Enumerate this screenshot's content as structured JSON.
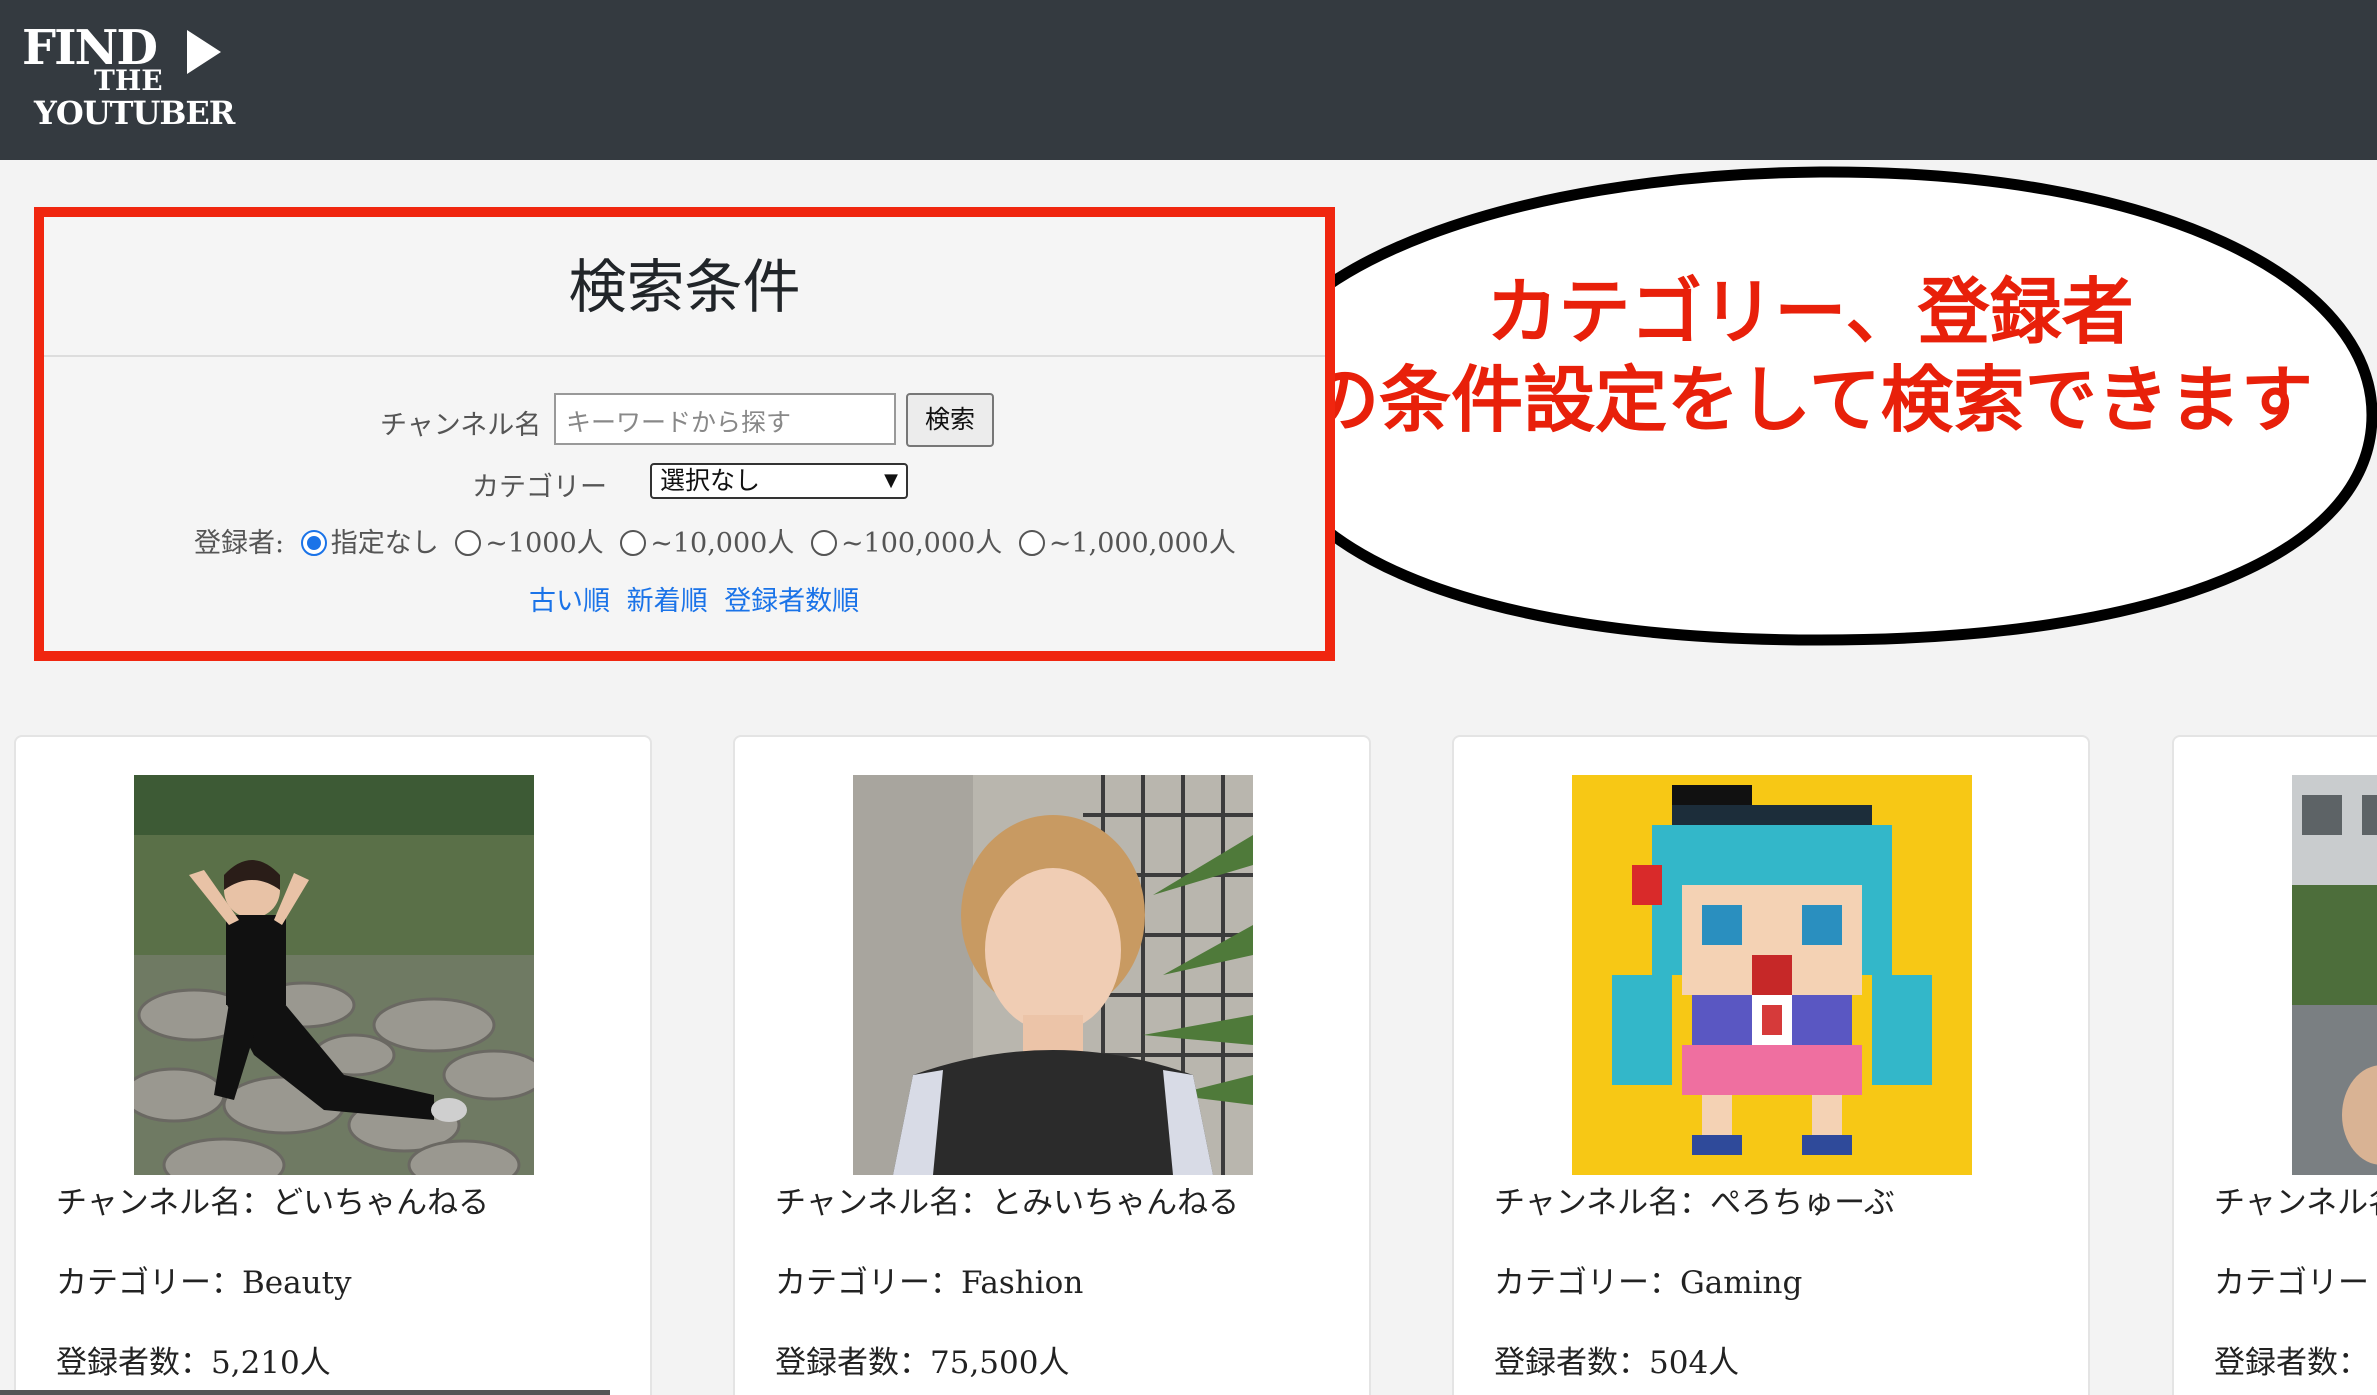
{
  "header": {
    "logo": {
      "line1": "FIND",
      "line2": "THE",
      "line3": "YOUTUBER"
    }
  },
  "search": {
    "title": "検索条件",
    "channel_label": "チャンネル名",
    "channel_placeholder": "キーワードから探す",
    "search_button": "検索",
    "category_label": "カテゴリー",
    "category_selected": "選択なし",
    "subscribers_label": "登録者:",
    "subscriber_options": [
      {
        "label": "指定なし",
        "checked": true
      },
      {
        "label": "~1000人",
        "checked": false
      },
      {
        "label": "~10,000人",
        "checked": false
      },
      {
        "label": "~100,000人",
        "checked": false
      },
      {
        "label": "~1,000,000人",
        "checked": false
      }
    ],
    "sort_links": [
      "古い順",
      "新着順",
      "登録者数順"
    ]
  },
  "callout": {
    "line1": "カテゴリー、登録者",
    "line2": "の条件設定をして検索できます"
  },
  "cards": [
    {
      "name": "チャンネル名：どいちゃんねる",
      "category": "カテゴリー：Beauty",
      "subscribers": "登録者数：5,210人"
    },
    {
      "name": "チャンネル名：とみいちゃんねる",
      "category": "カテゴリー：Fashion",
      "subscribers": "登録者数：75,500人"
    },
    {
      "name": "チャンネル名：ぺろちゅーぶ",
      "category": "カテゴリー：Gaming",
      "subscribers": "登録者数：504人"
    },
    {
      "name": "チャンネル名",
      "category": "カテゴリー",
      "subscribers": "登録者数："
    }
  ],
  "colors": {
    "header": "#343a40",
    "highlight_border": "#f0260f",
    "callout_text": "#e8200a",
    "link": "#1a73e8"
  }
}
